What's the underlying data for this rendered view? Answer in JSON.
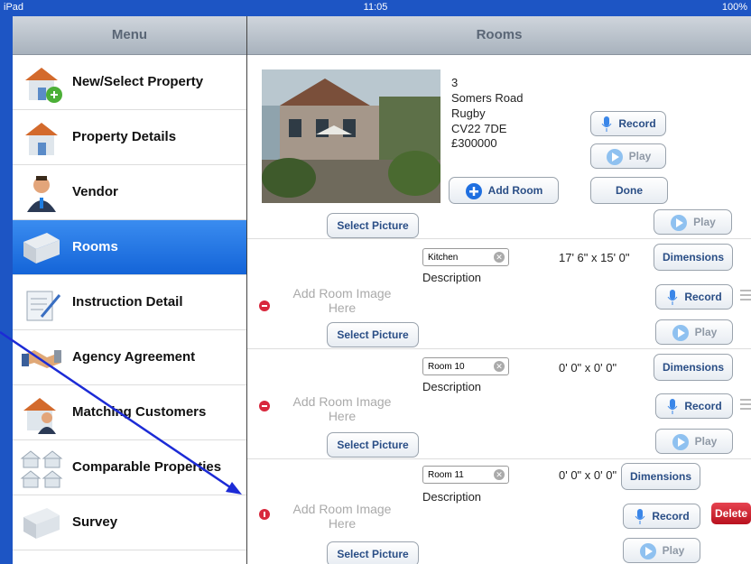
{
  "status": {
    "device": "iPad",
    "time": "11:05",
    "battery": "100%"
  },
  "left": {
    "title": "Menu",
    "items": [
      {
        "label": "New/Select Property",
        "icon": "house-add-icon"
      },
      {
        "label": "Property Details",
        "icon": "house-icon"
      },
      {
        "label": "Vendor",
        "icon": "person-icon"
      },
      {
        "label": "Rooms",
        "icon": "room-icon",
        "selected": true
      },
      {
        "label": "Instruction Detail",
        "icon": "document-pen-icon"
      },
      {
        "label": "Agency Agreement",
        "icon": "handshake-icon"
      },
      {
        "label": "Matching Customers",
        "icon": "house-person-icon"
      },
      {
        "label": "Comparable Properties",
        "icon": "houses-icon"
      },
      {
        "label": "Survey",
        "icon": "room-icon"
      }
    ]
  },
  "right": {
    "title": "Rooms",
    "property": {
      "line1": "3",
      "line2": "Somers Road",
      "line3": "Rugby",
      "line4": "CV22 7DE",
      "price": "£300000"
    },
    "buttons": {
      "record": "Record",
      "play": "Play",
      "add_room": "Add Room",
      "done": "Done",
      "select_picture": "Select Picture",
      "dimensions": "Dimensions",
      "delete": "Delete"
    },
    "add_image_text": "Add Room Image Here",
    "rooms": [
      {
        "name": "Kitchen",
        "dimensions": "17' 6\" x 15' 0\"",
        "description": "Description"
      },
      {
        "name": "Room 10",
        "dimensions": "0' 0\" x 0' 0\"",
        "description": "Description"
      },
      {
        "name": "Room 11",
        "dimensions": "0' 0\" x 0' 0\"",
        "description": "Description"
      }
    ]
  },
  "colors": {
    "accent": "#1d55c4",
    "selected": "#1464d8",
    "delete": "#d8283d"
  }
}
